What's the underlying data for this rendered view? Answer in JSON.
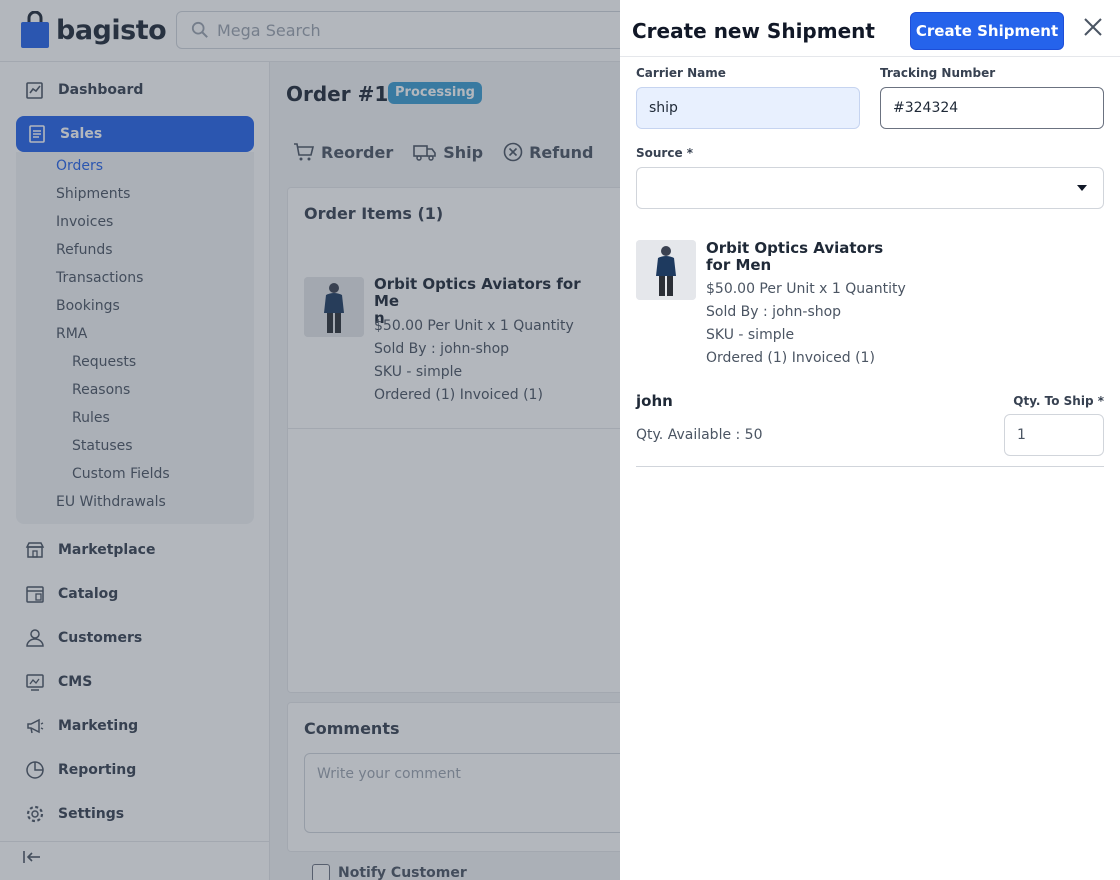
{
  "brand": {
    "name": "bagisto",
    "color": "#2563eb"
  },
  "search": {
    "placeholder": "Mega Search"
  },
  "sidebar": {
    "items": [
      {
        "label": "Dashboard",
        "icon": "dashboard-icon"
      },
      {
        "label": "Sales",
        "icon": "sales-icon",
        "active": true
      },
      {
        "label": "Marketplace",
        "icon": "store-icon"
      },
      {
        "label": "Catalog",
        "icon": "catalog-icon"
      },
      {
        "label": "Customers",
        "icon": "user-icon"
      },
      {
        "label": "CMS",
        "icon": "cms-icon"
      },
      {
        "label": "Marketing",
        "icon": "megaphone-icon"
      },
      {
        "label": "Reporting",
        "icon": "pie-chart-icon"
      },
      {
        "label": "Settings",
        "icon": "gear-icon"
      }
    ],
    "sales_sub": [
      "Orders",
      "Shipments",
      "Invoices",
      "Refunds",
      "Transactions",
      "Bookings",
      "RMA"
    ],
    "rma_sub": [
      "Requests",
      "Reasons",
      "Rules",
      "Statuses",
      "Custom Fields"
    ],
    "eu": "EU Withdrawals"
  },
  "order": {
    "title": "Order #1",
    "status": "Processing",
    "actions": [
      "Reorder",
      "Ship",
      "Refund"
    ],
    "items_title": "Order Items (1)",
    "comments_title": "Comments",
    "comment_placeholder": "Write your comment",
    "notify_label": "Notify Customer"
  },
  "drawer": {
    "title": "Create new Shipment",
    "submit_label": "Create Shipment",
    "carrier_label": "Carrier Name",
    "carrier_value": "ship",
    "tracking_label": "Tracking Number",
    "tracking_value": "#324324",
    "source_label": "Source *",
    "source_value": "",
    "vendor": "john",
    "qty_available": "Qty. Available : 50",
    "qty_label": "Qty. To Ship *",
    "qty_value": "1"
  },
  "product": {
    "name_bg": "Orbit Optics Aviators for Me\nn",
    "name": "Orbit Optics Aviators for Men",
    "price_line": "$50.00 Per Unit x 1 Quantity",
    "sold_by": "Sold By : john-shop",
    "sku": "SKU - simple",
    "ordered": "Ordered (1) Invoiced (1)"
  }
}
